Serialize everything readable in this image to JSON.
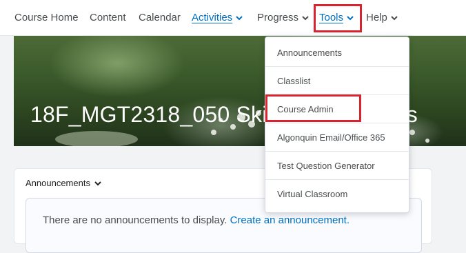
{
  "nav": {
    "items": [
      {
        "label": "Course Home"
      },
      {
        "label": "Content"
      },
      {
        "label": "Calendar"
      },
      {
        "label": "Activities"
      },
      {
        "label": "Progress"
      },
      {
        "label": "Tools"
      },
      {
        "label": "Help"
      }
    ]
  },
  "banner": {
    "title": "18F_MGT2318_050 Skills for Business"
  },
  "tools_menu": {
    "items": [
      {
        "label": "Announcements"
      },
      {
        "label": "Classlist"
      },
      {
        "label": "Course Admin"
      },
      {
        "label": "Algonquin Email/Office 365"
      },
      {
        "label": "Test Question Generator"
      },
      {
        "label": "Virtual Classroom"
      }
    ]
  },
  "announcements_widget": {
    "header": "Announcements",
    "empty_text": "There are no announcements to display.",
    "create_link": "Create an announcement."
  },
  "colors": {
    "accent": "#006fbf",
    "highlight": "#d9232e",
    "text": "#494c4e"
  }
}
